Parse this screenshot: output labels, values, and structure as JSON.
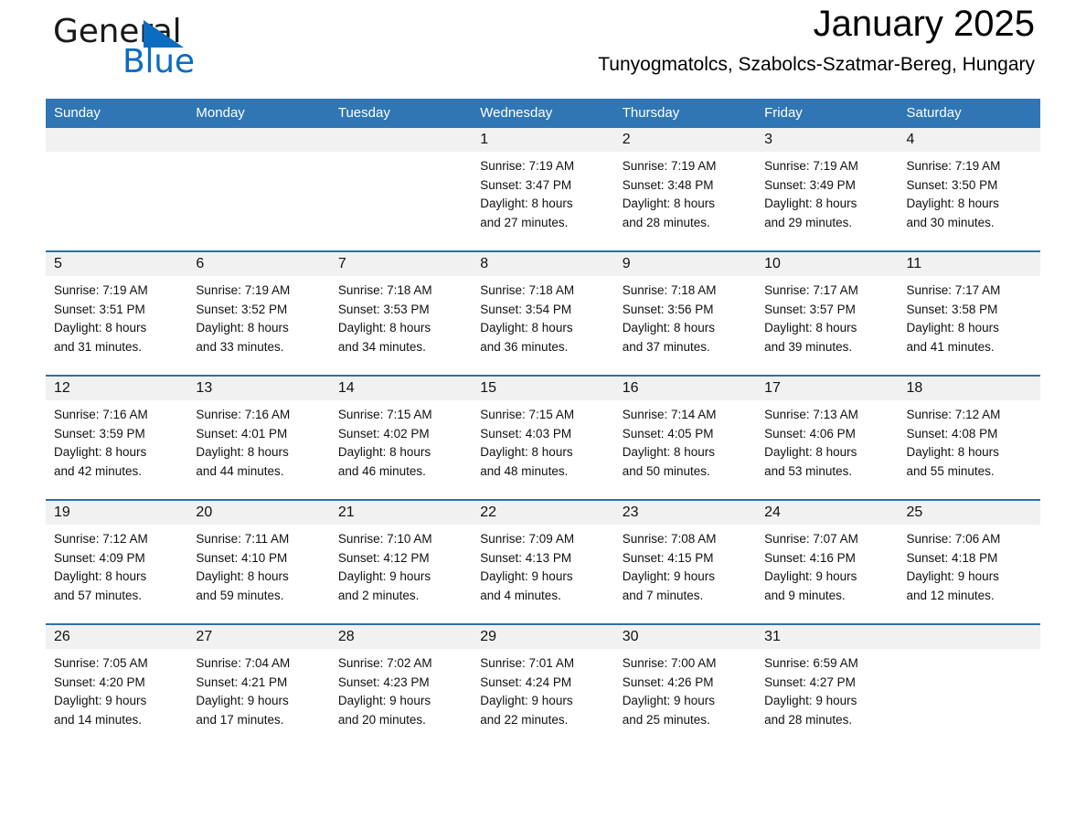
{
  "brand": {
    "name_part1": "General",
    "name_part2": "Blue",
    "triangle_color": "#0b6cc0",
    "blue_color": "#0b6cc0"
  },
  "header": {
    "title": "January 2025",
    "subtitle": "Tunyogmatolcs, Szabolcs-Szatmar-Bereg, Hungary"
  },
  "theme": {
    "header_blue": "#3076b4",
    "row_rule_blue": "#2f6fa8",
    "daynum_band": "#f1f1f1"
  },
  "calendar": {
    "weekday_headers": [
      "Sunday",
      "Monday",
      "Tuesday",
      "Wednesday",
      "Thursday",
      "Friday",
      "Saturday"
    ],
    "weeks": [
      [
        {
          "day": "",
          "lines": []
        },
        {
          "day": "",
          "lines": []
        },
        {
          "day": "",
          "lines": []
        },
        {
          "day": "1",
          "lines": [
            "Sunrise: 7:19 AM",
            "Sunset: 3:47 PM",
            "Daylight: 8 hours",
            "and 27 minutes."
          ]
        },
        {
          "day": "2",
          "lines": [
            "Sunrise: 7:19 AM",
            "Sunset: 3:48 PM",
            "Daylight: 8 hours",
            "and 28 minutes."
          ]
        },
        {
          "day": "3",
          "lines": [
            "Sunrise: 7:19 AM",
            "Sunset: 3:49 PM",
            "Daylight: 8 hours",
            "and 29 minutes."
          ]
        },
        {
          "day": "4",
          "lines": [
            "Sunrise: 7:19 AM",
            "Sunset: 3:50 PM",
            "Daylight: 8 hours",
            "and 30 minutes."
          ]
        }
      ],
      [
        {
          "day": "5",
          "lines": [
            "Sunrise: 7:19 AM",
            "Sunset: 3:51 PM",
            "Daylight: 8 hours",
            "and 31 minutes."
          ]
        },
        {
          "day": "6",
          "lines": [
            "Sunrise: 7:19 AM",
            "Sunset: 3:52 PM",
            "Daylight: 8 hours",
            "and 33 minutes."
          ]
        },
        {
          "day": "7",
          "lines": [
            "Sunrise: 7:18 AM",
            "Sunset: 3:53 PM",
            "Daylight: 8 hours",
            "and 34 minutes."
          ]
        },
        {
          "day": "8",
          "lines": [
            "Sunrise: 7:18 AM",
            "Sunset: 3:54 PM",
            "Daylight: 8 hours",
            "and 36 minutes."
          ]
        },
        {
          "day": "9",
          "lines": [
            "Sunrise: 7:18 AM",
            "Sunset: 3:56 PM",
            "Daylight: 8 hours",
            "and 37 minutes."
          ]
        },
        {
          "day": "10",
          "lines": [
            "Sunrise: 7:17 AM",
            "Sunset: 3:57 PM",
            "Daylight: 8 hours",
            "and 39 minutes."
          ]
        },
        {
          "day": "11",
          "lines": [
            "Sunrise: 7:17 AM",
            "Sunset: 3:58 PM",
            "Daylight: 8 hours",
            "and 41 minutes."
          ]
        }
      ],
      [
        {
          "day": "12",
          "lines": [
            "Sunrise: 7:16 AM",
            "Sunset: 3:59 PM",
            "Daylight: 8 hours",
            "and 42 minutes."
          ]
        },
        {
          "day": "13",
          "lines": [
            "Sunrise: 7:16 AM",
            "Sunset: 4:01 PM",
            "Daylight: 8 hours",
            "and 44 minutes."
          ]
        },
        {
          "day": "14",
          "lines": [
            "Sunrise: 7:15 AM",
            "Sunset: 4:02 PM",
            "Daylight: 8 hours",
            "and 46 minutes."
          ]
        },
        {
          "day": "15",
          "lines": [
            "Sunrise: 7:15 AM",
            "Sunset: 4:03 PM",
            "Daylight: 8 hours",
            "and 48 minutes."
          ]
        },
        {
          "day": "16",
          "lines": [
            "Sunrise: 7:14 AM",
            "Sunset: 4:05 PM",
            "Daylight: 8 hours",
            "and 50 minutes."
          ]
        },
        {
          "day": "17",
          "lines": [
            "Sunrise: 7:13 AM",
            "Sunset: 4:06 PM",
            "Daylight: 8 hours",
            "and 53 minutes."
          ]
        },
        {
          "day": "18",
          "lines": [
            "Sunrise: 7:12 AM",
            "Sunset: 4:08 PM",
            "Daylight: 8 hours",
            "and 55 minutes."
          ]
        }
      ],
      [
        {
          "day": "19",
          "lines": [
            "Sunrise: 7:12 AM",
            "Sunset: 4:09 PM",
            "Daylight: 8 hours",
            "and 57 minutes."
          ]
        },
        {
          "day": "20",
          "lines": [
            "Sunrise: 7:11 AM",
            "Sunset: 4:10 PM",
            "Daylight: 8 hours",
            "and 59 minutes."
          ]
        },
        {
          "day": "21",
          "lines": [
            "Sunrise: 7:10 AM",
            "Sunset: 4:12 PM",
            "Daylight: 9 hours",
            "and 2 minutes."
          ]
        },
        {
          "day": "22",
          "lines": [
            "Sunrise: 7:09 AM",
            "Sunset: 4:13 PM",
            "Daylight: 9 hours",
            "and 4 minutes."
          ]
        },
        {
          "day": "23",
          "lines": [
            "Sunrise: 7:08 AM",
            "Sunset: 4:15 PM",
            "Daylight: 9 hours",
            "and 7 minutes."
          ]
        },
        {
          "day": "24",
          "lines": [
            "Sunrise: 7:07 AM",
            "Sunset: 4:16 PM",
            "Daylight: 9 hours",
            "and 9 minutes."
          ]
        },
        {
          "day": "25",
          "lines": [
            "Sunrise: 7:06 AM",
            "Sunset: 4:18 PM",
            "Daylight: 9 hours",
            "and 12 minutes."
          ]
        }
      ],
      [
        {
          "day": "26",
          "lines": [
            "Sunrise: 7:05 AM",
            "Sunset: 4:20 PM",
            "Daylight: 9 hours",
            "and 14 minutes."
          ]
        },
        {
          "day": "27",
          "lines": [
            "Sunrise: 7:04 AM",
            "Sunset: 4:21 PM",
            "Daylight: 9 hours",
            "and 17 minutes."
          ]
        },
        {
          "day": "28",
          "lines": [
            "Sunrise: 7:02 AM",
            "Sunset: 4:23 PM",
            "Daylight: 9 hours",
            "and 20 minutes."
          ]
        },
        {
          "day": "29",
          "lines": [
            "Sunrise: 7:01 AM",
            "Sunset: 4:24 PM",
            "Daylight: 9 hours",
            "and 22 minutes."
          ]
        },
        {
          "day": "30",
          "lines": [
            "Sunrise: 7:00 AM",
            "Sunset: 4:26 PM",
            "Daylight: 9 hours",
            "and 25 minutes."
          ]
        },
        {
          "day": "31",
          "lines": [
            "Sunrise: 6:59 AM",
            "Sunset: 4:27 PM",
            "Daylight: 9 hours",
            "and 28 minutes."
          ]
        },
        {
          "day": "",
          "lines": []
        }
      ]
    ]
  }
}
